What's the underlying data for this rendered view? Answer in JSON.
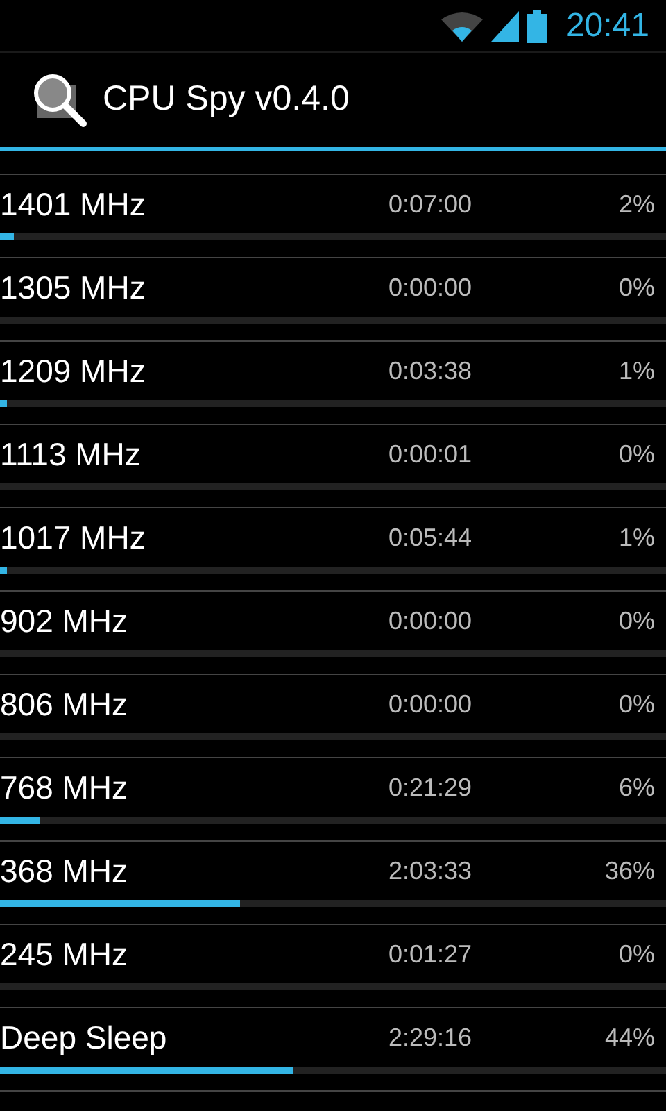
{
  "status_bar": {
    "time": "20:41"
  },
  "action_bar": {
    "title": "CPU Spy v0.4.0"
  },
  "states": [
    {
      "name": "1401 MHz",
      "time": "0:07:00",
      "percent": "2%",
      "level": 0.02
    },
    {
      "name": "1305 MHz",
      "time": "0:00:00",
      "percent": "0%"
    },
    {
      "name": "1209 MHz",
      "time": "0:03:38",
      "percent": "1%",
      "level": 0.01
    },
    {
      "name": "1113 MHz",
      "time": "0:00:01",
      "percent": "0%"
    },
    {
      "name": "1017 MHz",
      "time": "0:05:44",
      "percent": "1%",
      "level": 0.01
    },
    {
      "name": "902 MHz",
      "time": "0:00:00",
      "percent": "0%"
    },
    {
      "name": "806 MHz",
      "time": "0:00:00",
      "percent": "0%"
    },
    {
      "name": "768 MHz",
      "time": "0:21:29",
      "percent": "6%",
      "level": 0.06
    },
    {
      "name": "368 MHz",
      "time": "2:03:33",
      "percent": "36%",
      "level": 0.36
    },
    {
      "name": "245 MHz",
      "time": "0:01:27",
      "percent": "0%"
    },
    {
      "name": "Deep Sleep",
      "time": "2:29:16",
      "percent": "44%",
      "level": 0.44
    }
  ]
}
